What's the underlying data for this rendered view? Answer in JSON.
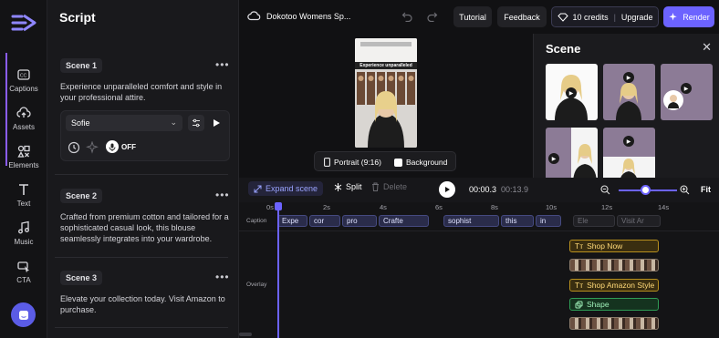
{
  "rail": {
    "items": [
      {
        "label": "Captions",
        "icon": "captions-icon"
      },
      {
        "label": "Assets",
        "icon": "upload-cloud-icon"
      },
      {
        "label": "Elements",
        "icon": "shapes-icon"
      },
      {
        "label": "Text",
        "icon": "text-icon"
      },
      {
        "label": "Music",
        "icon": "music-icon"
      },
      {
        "label": "CTA",
        "icon": "cta-icon"
      }
    ]
  },
  "script": {
    "title": "Script",
    "scenes": [
      {
        "tag": "Scene 1",
        "text": "Experience unparalleled comfort and style in your professional attire."
      },
      {
        "tag": "Scene 2",
        "text": "Crafted from premium cotton and tailored for a sophisticated casual look, this blouse seamlessly integrates into your wardrobe."
      },
      {
        "tag": "Scene 3",
        "text": "Elevate your collection today. Visit Amazon to purchase."
      }
    ],
    "voice": {
      "name": "Sofie",
      "toggle": "OFF"
    }
  },
  "topbar": {
    "project_name": "Dokotoo Womens Sp...",
    "tutorial": "Tutorial",
    "feedback": "Feedback",
    "credits": "10 credits",
    "upgrade": "Upgrade",
    "render": "Render"
  },
  "preview": {
    "caption_text": "Experience unparalleled",
    "portrait": "Portrait (9:16)",
    "background": "Background"
  },
  "scene_panel": {
    "title": "Scene"
  },
  "timeline_toolbar": {
    "expand": "Expand scene",
    "split": "Split",
    "delete": "Delete",
    "current_time": "00:00.3",
    "total_time": "00:13.9",
    "fit": "Fit"
  },
  "timeline": {
    "ticks": [
      "0s",
      "2s",
      "4s",
      "6s",
      "8s",
      "10s",
      "12s",
      "14s"
    ],
    "caption_label": "Caption",
    "overlay_label": "Overlay",
    "captions": [
      "Expe",
      "cor",
      "pro",
      "Crafte",
      "sophist",
      "this",
      "in",
      "Ele",
      "Visit Ar"
    ],
    "overlays": [
      {
        "type": "text",
        "label": "Shop Now"
      },
      {
        "type": "image",
        "label": ""
      },
      {
        "type": "text",
        "label": "Shop Amazon Style"
      },
      {
        "type": "shape",
        "label": "Shape"
      },
      {
        "type": "image",
        "label": ""
      }
    ]
  },
  "colors": {
    "accent": "#6c63ff",
    "render": "#6c63ff",
    "help": "#5b5ce6",
    "scene_active": "#8a5cf6"
  }
}
